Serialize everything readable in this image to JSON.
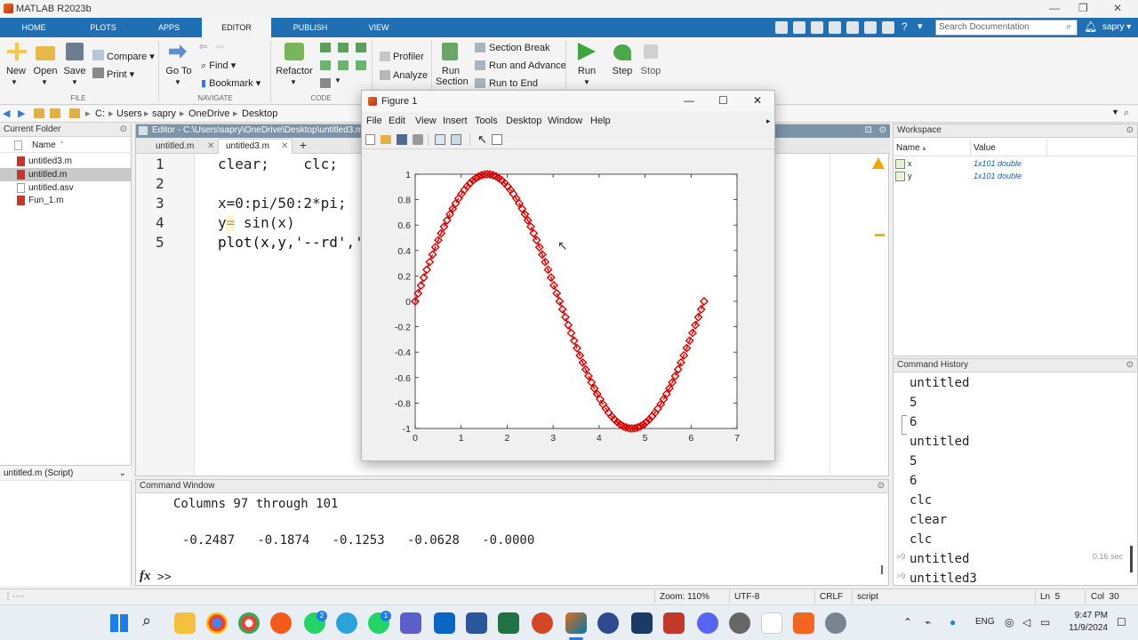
{
  "app": {
    "title": "MATLAB R2023b"
  },
  "tabs": [
    "HOME",
    "PLOTS",
    "APPS",
    "EDITOR",
    "PUBLISH",
    "VIEW"
  ],
  "search": {
    "placeholder": "Search Documentation"
  },
  "user": "sapry",
  "ribbon": {
    "file": {
      "new": "New",
      "open": "Open",
      "save": "Save",
      "compare": "Compare",
      "print": "Print",
      "group": "FILE"
    },
    "navigate": {
      "goto_line1": "Go To",
      "find": "Find",
      "bookmark": "Bookmark",
      "group": "NAVIGATE"
    },
    "code": {
      "refactor": "Refactor",
      "group": "CODE"
    },
    "analyze": {
      "profiler": "Profiler",
      "analyze": "Analyze"
    },
    "section": {
      "run_section_line1": "Run",
      "run_section_line2": "Section",
      "section_break": "Section Break",
      "run_and_advance": "Run and Advance",
      "run_to_end": "Run to End"
    },
    "run": {
      "run": "Run",
      "step": "Step",
      "stop": "Stop"
    }
  },
  "address": {
    "parts": [
      "C:",
      "Users",
      "sapry",
      "OneDrive",
      "Desktop"
    ]
  },
  "current_folder": {
    "title": "Current Folder",
    "column": "Name",
    "files": [
      "untitled3.m",
      "untitled.m",
      "untitled.asv",
      "Fun_1.m"
    ],
    "selected_index": 1,
    "details": "untitled.m  (Script)"
  },
  "editor": {
    "title": "Editor - C:\\Users\\sapry\\OneDrive\\Desktop\\untitled3.m",
    "tabs": [
      "untitled.m",
      "untitled3.m"
    ],
    "active_tab": 1,
    "lines": [
      {
        "num": "1",
        "code": "clear;    clc;"
      },
      {
        "num": "2",
        "code": ""
      },
      {
        "num": "3",
        "code": "x=0:pi/50:2*pi;"
      },
      {
        "num": "4",
        "code": "y= sin(x)"
      },
      {
        "num": "5",
        "code": "plot(x,y,'--rd','"
      }
    ]
  },
  "workspace": {
    "title": "Workspace",
    "col_name": "Name",
    "col_value": "Value",
    "vars": [
      {
        "name": "x",
        "value": "1x101 double"
      },
      {
        "name": "y",
        "value": "1x101 double"
      }
    ]
  },
  "command_history": {
    "title": "Command History",
    "items": [
      "untitled",
      "5",
      "6",
      "untitled",
      "5",
      "6",
      "clc",
      "clear",
      "clc",
      "untitled",
      "untitled3"
    ],
    "timing": "0.16 sec"
  },
  "command_window": {
    "title": "Command Window",
    "line1": "Columns 97 through 101",
    "values": [
      "-0.2487",
      "-0.1874",
      "-0.1253",
      "-0.0628",
      "-0.0000"
    ],
    "fx": "fx",
    "prompt": ">>"
  },
  "figure": {
    "title": "Figure 1",
    "menu": [
      "File",
      "Edit",
      "View",
      "Insert",
      "Tools",
      "Desktop",
      "Window",
      "Help"
    ]
  },
  "chart_data": {
    "type": "line",
    "function": "y = sin(x)",
    "x_range": [
      0,
      6.2832
    ],
    "points": 101,
    "line_style": "--",
    "marker": "diamond",
    "color": "#d40000",
    "xlim": [
      0,
      7
    ],
    "ylim": [
      -1,
      1
    ],
    "xticks": [
      "0",
      "1",
      "2",
      "3",
      "4",
      "5",
      "6",
      "7"
    ],
    "yticks": [
      "1",
      "0.8",
      "0.6",
      "0.4",
      "0.2",
      "0",
      "-0.2",
      "-0.4",
      "-0.6",
      "-0.8",
      "-1"
    ],
    "grid": false
  },
  "statusbar": {
    "zoom": "Zoom: 110%",
    "encoding": "UTF-8",
    "eol": "CRLF",
    "type": "script",
    "ln": "Ln  5",
    "col": "Col  30"
  },
  "taskbar": {
    "lang": "ENG",
    "time": "9:47 PM",
    "date": "11/9/2024"
  }
}
